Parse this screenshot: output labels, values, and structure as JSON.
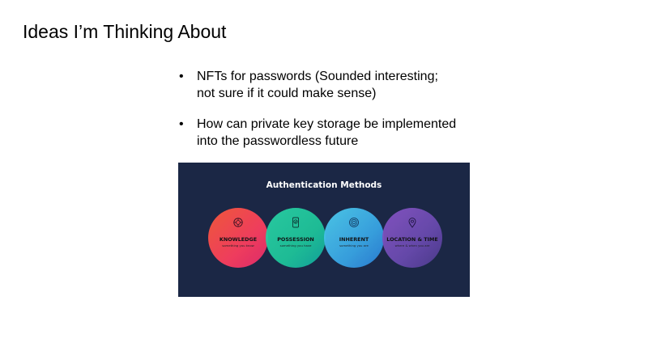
{
  "slide": {
    "title": "Ideas I’m Thinking About",
    "bullets": [
      {
        "marker": "•",
        "text": "NFTs for passwords (Sounded interesting;\nnot sure if it could make sense)"
      },
      {
        "marker": "•",
        "text": "How can private key storage be implemented\ninto the passwordless future"
      }
    ]
  },
  "figure": {
    "title": "Authentication Methods",
    "background": "#1b2745",
    "methods": [
      {
        "label": "KNOWLEDGE",
        "sub": "something you know",
        "icon": "brain-icon"
      },
      {
        "label": "POSSESSION",
        "sub": "something you have",
        "icon": "phone-check-icon"
      },
      {
        "label": "INHERENT",
        "sub": "something you are",
        "icon": "fingerprint-icon"
      },
      {
        "label": "LOCATION & TIME",
        "sub": "where & when you are",
        "icon": "location-pin-icon"
      }
    ]
  }
}
